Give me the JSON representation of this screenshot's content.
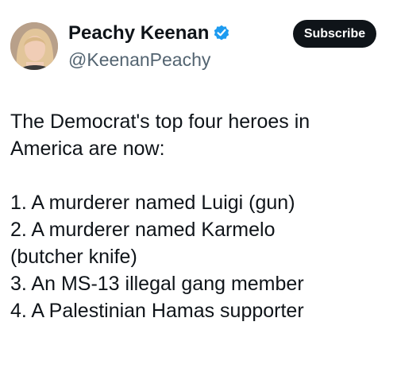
{
  "author": {
    "display_name": "Peachy Keenan",
    "handle": "@KeenanPeachy"
  },
  "subscribe_label": "Subscribe",
  "colors": {
    "verified": "#1d9bf0",
    "button_bg": "#0f1419",
    "handle": "#536471"
  },
  "icons": {
    "verified": "verified-badge-icon"
  },
  "tweet": {
    "intro_line_1": "The Democrat's top four heroes in",
    "intro_line_2": "America are now:",
    "list": [
      "1. A murderer named Luigi (gun)",
      "2. A murderer named Karmelo",
      "(butcher knife)",
      "3. An MS-13 illegal gang member",
      "4. A Palestinian Hamas supporter"
    ]
  }
}
